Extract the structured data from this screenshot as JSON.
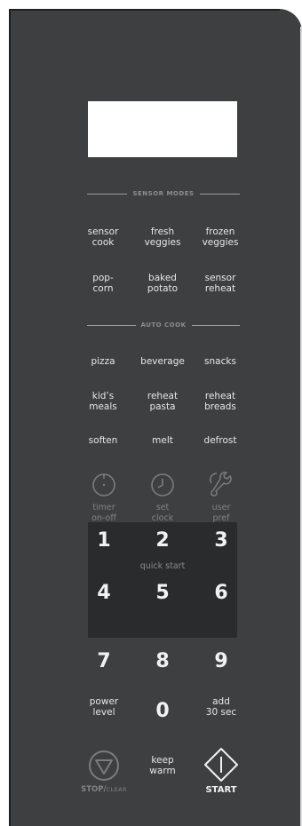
{
  "sections": {
    "sensor_modes": "SENSOR MODES",
    "auto_cook": "AUTO COOK"
  },
  "sensor_buttons": [
    {
      "l1": "sensor",
      "l2": "cook"
    },
    {
      "l1": "fresh",
      "l2": "veggies"
    },
    {
      "l1": "frozen",
      "l2": "veggies"
    },
    {
      "l1": "pop-",
      "l2": "corn"
    },
    {
      "l1": "baked",
      "l2": "potato"
    },
    {
      "l1": "sensor",
      "l2": "reheat"
    }
  ],
  "auto_buttons": [
    {
      "l1": "pizza"
    },
    {
      "l1": "beverage"
    },
    {
      "l1": "snacks"
    },
    {
      "l1": "kid’s",
      "l2": "meals"
    },
    {
      "l1": "reheat",
      "l2": "pasta"
    },
    {
      "l1": "reheat",
      "l2": "breads"
    },
    {
      "l1": "soften"
    },
    {
      "l1": "melt"
    },
    {
      "l1": "defrost"
    }
  ],
  "function_buttons": [
    {
      "l1": "timer",
      "l2": "on-off",
      "icon": "timer-icon"
    },
    {
      "l1": "set",
      "l2": "clock",
      "icon": "clock-icon"
    },
    {
      "l1": "user",
      "l2": "pref",
      "icon": "wrench-icon"
    }
  ],
  "keypad": {
    "digits": [
      "1",
      "2",
      "3",
      "4",
      "5",
      "6"
    ],
    "quick_start": "quick start"
  },
  "lower": {
    "seven": "7",
    "eight": "8",
    "nine": "9",
    "zero": "0",
    "power_l1": "power",
    "power_l2": "level",
    "add_l1": "add",
    "add_l2": "30 sec",
    "keep_l1": "keep",
    "keep_l2": "warm",
    "stop": "STOP/",
    "clear": "CLEAR",
    "start": "START"
  },
  "colors": {
    "panel": "#3e3f41",
    "keypad": "#2a2b2d",
    "text": "#e7e7e8",
    "dim_text": "#828385"
  }
}
